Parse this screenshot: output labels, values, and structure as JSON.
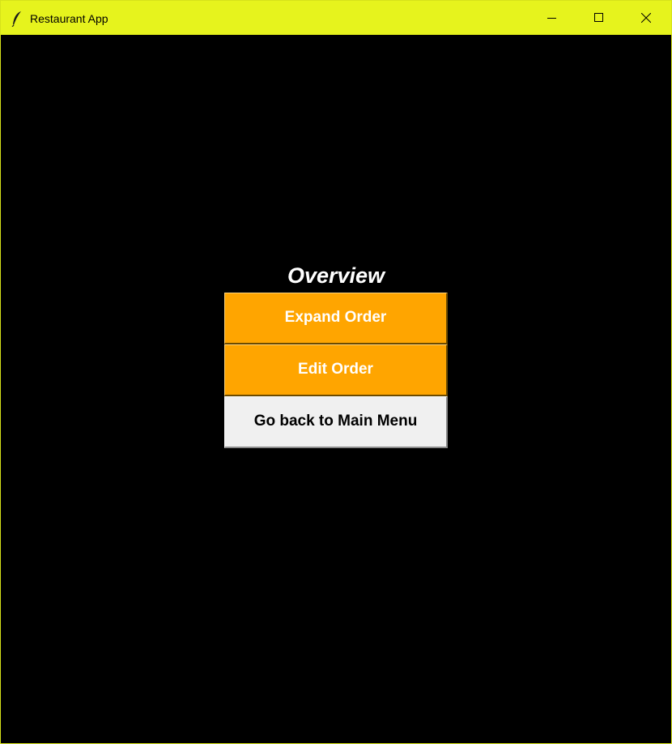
{
  "window": {
    "title": "Restaurant App",
    "icon": "feather-icon",
    "controls": [
      "minimize-icon",
      "maximize-icon",
      "close-icon"
    ]
  },
  "main": {
    "heading": "Overview",
    "buttons": [
      {
        "label": "Expand Order",
        "color": "#ffa500"
      },
      {
        "label": "Edit Order",
        "color": "#ffa500"
      },
      {
        "label": "Go back to Main Menu",
        "color": "#f0f0f0"
      }
    ]
  },
  "colors": {
    "titlebar": "#e6f31d",
    "background": "#000000",
    "accent": "#ffa500"
  }
}
